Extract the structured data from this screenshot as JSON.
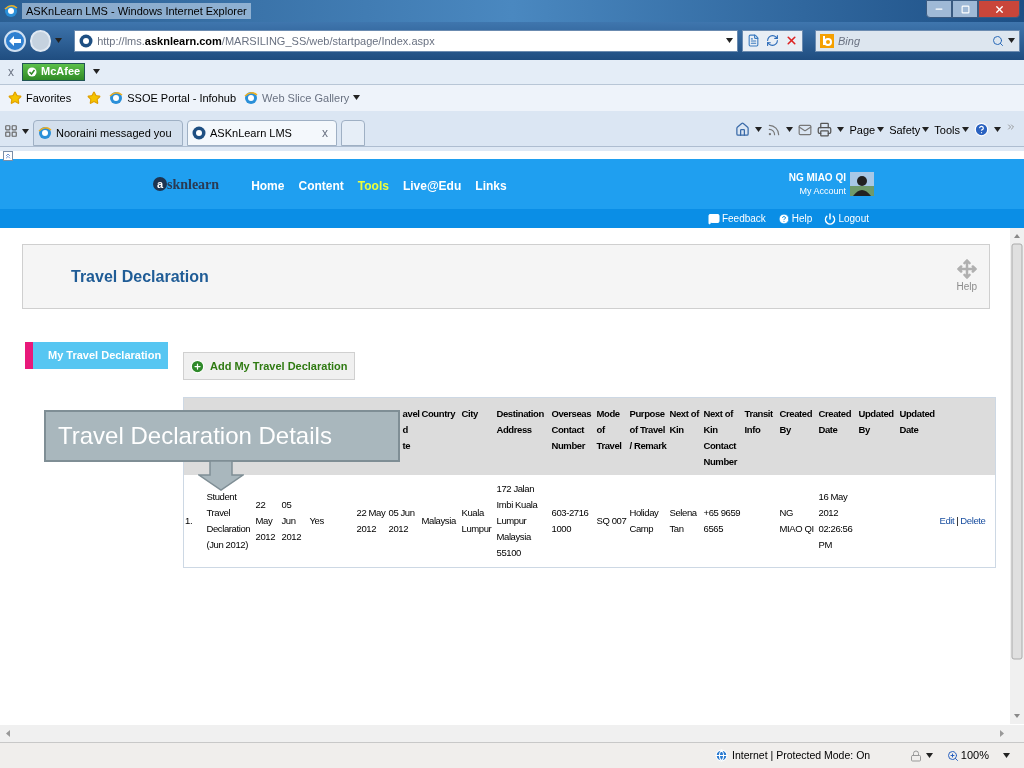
{
  "window": {
    "title": "ASKnLearn LMS - Windows Internet Explorer"
  },
  "address_bar": {
    "url": "http://lms.**asknlearn.com**/MARSILING_SS/web/startpage/Index.aspx"
  },
  "search": {
    "placeholder": "Bing"
  },
  "addon_bar": {
    "close": "x",
    "addon": "McAfee"
  },
  "favorites": {
    "label": "Favorites",
    "links": [
      "SSOE Portal - Infohub",
      "Web Slice Gallery"
    ]
  },
  "tabs": [
    {
      "label": "Nooraini messaged you",
      "selected": false
    },
    {
      "label": "ASKnLearn LMS",
      "selected": true,
      "close": "x"
    }
  ],
  "commands": [
    "Page",
    "Safety",
    "Tools"
  ],
  "site": {
    "logo": {
      "mark": "a",
      "text": "sknlearn"
    },
    "nav": [
      {
        "label": "Home",
        "selected": false
      },
      {
        "label": "Content",
        "selected": false
      },
      {
        "label": "Tools",
        "selected": true
      },
      {
        "label": "Live@Edu",
        "selected": false
      },
      {
        "label": "Links",
        "selected": false
      }
    ],
    "user": "NG MIAO QI",
    "account": "My Account",
    "links": [
      {
        "kind": "feedback",
        "label": "Feedback"
      },
      {
        "kind": "help",
        "label": "Help"
      },
      {
        "kind": "logout",
        "label": "Logout"
      }
    ]
  },
  "page": {
    "title": "Travel Declaration",
    "help": "Help"
  },
  "side_menu": [
    {
      "label": "My Travel Declaration",
      "selected": true
    }
  ],
  "add_button": "Add My Travel Declaration",
  "table": {
    "columns": [
      "",
      "",
      "",
      "",
      "",
      "",
      "avel\nd\nte",
      "Country",
      "City",
      "Destination Address",
      "Overseas Contact Number",
      "Mode of Travel",
      "Purpose of Travel / Remark",
      "Next of Kin",
      "Next of Kin Contact Number",
      "Transit Info",
      "Created By",
      "Created Date",
      "Updated By",
      "Updated Date"
    ],
    "rows": [
      {
        "cells": [
          "1.",
          "Student Travel Declaration (Jun 2012)",
          "22 May 2012",
          "05 Jun 2012",
          "Yes",
          "22 May 2012",
          "05 Jun 2012",
          "Malaysia",
          "Kuala Lumpur",
          "172 Jalan Imbi Kuala Lumpur Malaysia 55100",
          "603-2716 1000",
          "SQ 007",
          "Holiday Camp",
          "Selena Tan",
          "+65 9659 6565",
          null,
          "NG MIAO QI",
          "16 May 2012 02:26:56 PM",
          null,
          null
        ],
        "actions": [
          "Edit",
          "|",
          "Delete"
        ]
      }
    ]
  },
  "callout": "Travel Declaration Details",
  "status_bar": {
    "zone": "Internet | Protected Mode: On",
    "zoom": "100%"
  }
}
